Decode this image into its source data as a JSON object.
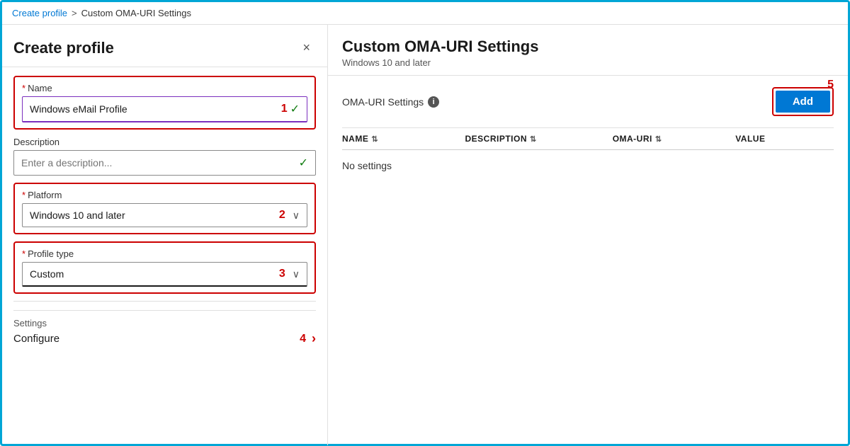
{
  "breadcrumb": {
    "link": "Create profile",
    "separator": ">",
    "current": "Custom OMA-URI Settings"
  },
  "left_panel": {
    "title": "Create profile",
    "close_label": "×",
    "name_field": {
      "label": "Name",
      "required": true,
      "value": "Windows eMail Profile",
      "badge": "1"
    },
    "description_field": {
      "label": "Description",
      "placeholder": "Enter a description..."
    },
    "platform_field": {
      "label": "Platform",
      "required": true,
      "value": "Windows 10 and later",
      "badge": "2"
    },
    "profile_type_field": {
      "label": "Profile type",
      "required": true,
      "value": "Custom",
      "badge": "3"
    },
    "settings": {
      "label": "Settings",
      "badge": "4",
      "configure_label": "Configure"
    }
  },
  "right_panel": {
    "title": "Custom OMA-URI Settings",
    "subtitle": "Windows 10 and later",
    "oma_label": "OMA-URI Settings",
    "add_button": "Add",
    "add_badge": "5",
    "table": {
      "columns": [
        "NAME",
        "DESCRIPTION",
        "OMA-URI",
        "VALUE"
      ],
      "empty_message": "No settings"
    }
  }
}
